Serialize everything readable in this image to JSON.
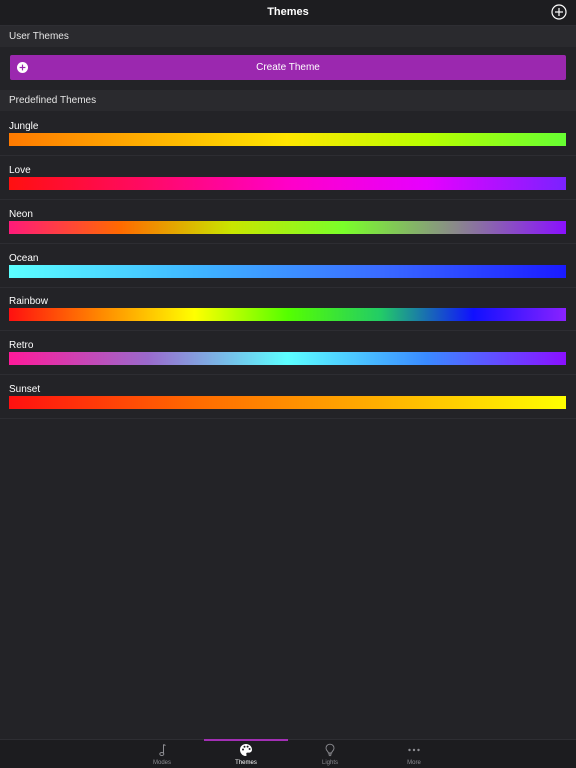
{
  "navbar": {
    "title": "Themes",
    "add_icon": "plus-circle-icon"
  },
  "user_themes": {
    "header": "User Themes",
    "create_button_label": "Create Theme",
    "create_button_color": "#9b28af"
  },
  "predefined_themes": {
    "header": "Predefined Themes",
    "items": [
      {
        "name": "Jungle",
        "colors": [
          "#ff7a00",
          "#ffb000",
          "#ffe600",
          "#b8ff00",
          "#66ff33"
        ]
      },
      {
        "name": "Love",
        "colors": [
          "#ff1010",
          "#ff0a66",
          "#ff00c8",
          "#e600ff",
          "#7a22ff"
        ]
      },
      {
        "name": "Neon",
        "colors": [
          "#ff1a7a",
          "#ff6a00",
          "#c8e600",
          "#7aff2a",
          "#8a8a8a",
          "#8a10ff"
        ]
      },
      {
        "name": "Ocean",
        "colors": [
          "#5cffff",
          "#3fb6ff",
          "#3a6bff",
          "#1a1aff"
        ]
      },
      {
        "name": "Rainbow",
        "colors": [
          "#ff1010",
          "#ff8a00",
          "#ffff00",
          "#55ff00",
          "#22cc66",
          "#1010ff",
          "#8a22ff"
        ]
      },
      {
        "name": "Retro",
        "colors": [
          "#ff1a9a",
          "#9a6acc",
          "#5cffff",
          "#3a8aff",
          "#8a10ff"
        ]
      },
      {
        "name": "Sunset",
        "colors": [
          "#ff1010",
          "#ff6a00",
          "#ffb000",
          "#ffff00"
        ]
      }
    ]
  },
  "tabbar": {
    "accent_color": "#a22fb4",
    "tabs": [
      {
        "label": "Modes",
        "icon": "music-note-icon",
        "active": false
      },
      {
        "label": "Themes",
        "icon": "palette-icon",
        "active": true
      },
      {
        "label": "Lights",
        "icon": "lightbulb-icon",
        "active": false
      },
      {
        "label": "More",
        "icon": "more-dots-icon",
        "active": false
      }
    ]
  }
}
